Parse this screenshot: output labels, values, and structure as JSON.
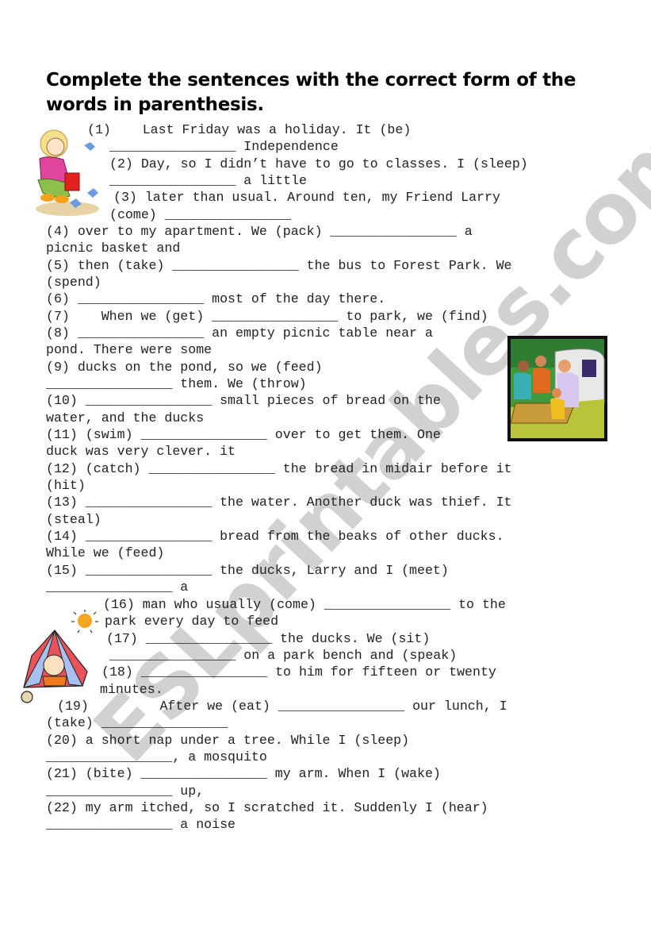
{
  "title": "Complete the sentences with the correct form of the words in parenthesis.",
  "watermark": "ESLprintables.com",
  "blank": "________________",
  "lines": [
    "(1)    Last Friday was a holiday. It (be)",
    "________________ Independence",
    "(2) Day, so I didn’t have to go to classes. I (sleep)",
    "________________ a little",
    "(3) later than usual. Around ten, my Friend Larry",
    "(come) ________________",
    "(4) over to my apartment. We (pack) ________________ a",
    "picnic basket and",
    "(5) then (take) ________________ the bus to Forest Park. We",
    "(spend)",
    "(6) ________________ most of the day there.",
    "(7)    When we (get) ________________ to park, we (find)",
    "(8) ________________ an empty picnic table near a",
    "pond. There were some",
    "(9) ducks on the pond, so we (feed)",
    "________________ them. We (throw)",
    "(10) ________________ small pieces of bread on the",
    "water, and the ducks",
    "(11) (swim) ________________ over to get them. One",
    "duck was very clever. it",
    "(12) (catch) ________________ the bread in midair before it",
    "(hit)",
    "(13) ________________ the water. Another duck was thief. It",
    "(steal)",
    "(14) ________________ bread from the beaks of other ducks.",
    "While we (feed)",
    "(15) ________________ the ducks, Larry and I (meet)",
    "________________ a",
    "(16) man who usually (come) ________________ to the",
    "park every day to feed",
    "(17) ________________ the ducks. We (sit)",
    "________________ on a park bench and (speak)",
    "(18) ________________ to him for fifteen or twenty",
    "minutes.",
    "(19)         After we (eat) ________________ our lunch, I",
    "(take) ________________",
    "(20) a short nap under a tree. While I (sleep)",
    "________________, a mosquito",
    "(21) (bite) ________________ my arm. When I (wake)",
    "________________ up,",
    "(22) my arm itched, so I scratched it. Suddenly I (hear)",
    "________________ a noise"
  ],
  "images": {
    "girl": "girl-feeding-birds-clipart",
    "picnic": "family-picnic-clipart",
    "tent": "man-in-tent-clipart"
  }
}
